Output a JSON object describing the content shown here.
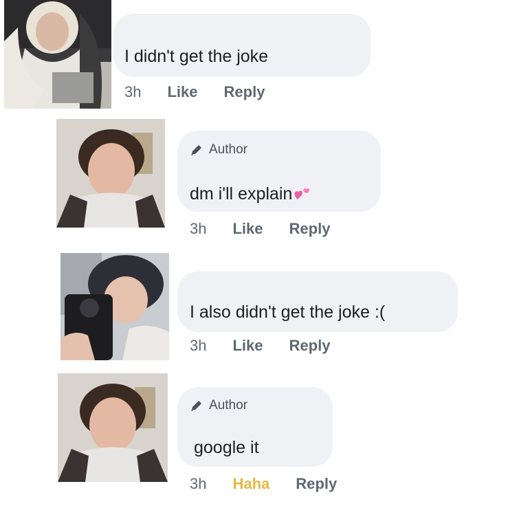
{
  "comments": [
    {
      "author_badge": "",
      "text": "I didn't get the joke",
      "time": "3h",
      "like_label": "Like",
      "reply_label": "Reply"
    },
    {
      "author_badge": "Author",
      "text": "dm i'll explain",
      "emoji": "two-hearts-icon",
      "time": "3h",
      "like_label": "Like",
      "reply_label": "Reply"
    },
    {
      "author_badge": "",
      "text": "I also didn't get the joke :(",
      "time": "3h",
      "like_label": "Like",
      "reply_label": "Reply"
    },
    {
      "author_badge": "Author",
      "text": "google it",
      "time": "3h",
      "reaction_label": "Haha",
      "reaction_color": "#e8b73f",
      "reply_label": "Reply"
    }
  ],
  "icons": {
    "author": "pencil-icon"
  },
  "colors": {
    "bubble": "#f0f1f4",
    "action_text": "#606770"
  }
}
